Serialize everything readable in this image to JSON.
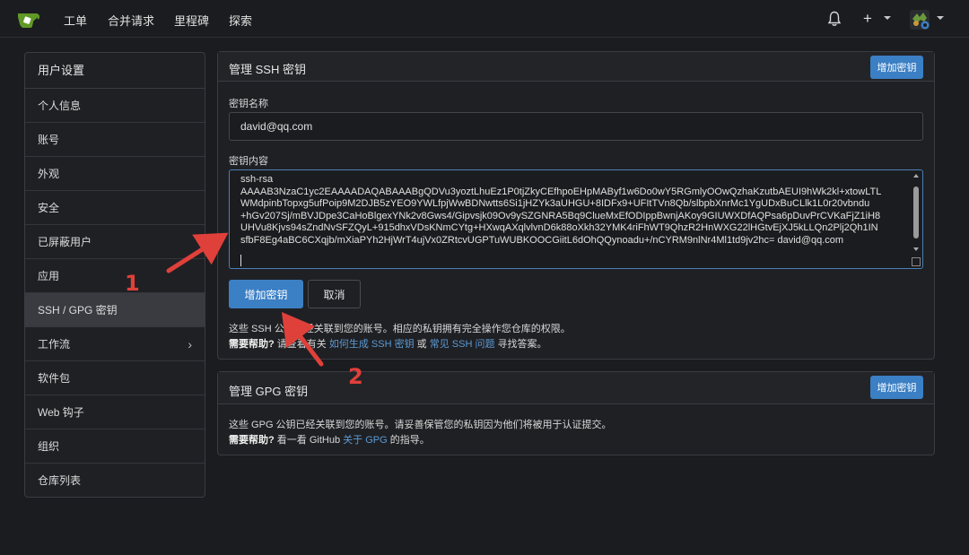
{
  "nav": {
    "links": [
      "工单",
      "合并请求",
      "里程碑",
      "探索"
    ],
    "plus_label": "+"
  },
  "sidebar": {
    "title": "用户设置",
    "items": [
      {
        "label": "个人信息"
      },
      {
        "label": "账号"
      },
      {
        "label": "外观"
      },
      {
        "label": "安全"
      },
      {
        "label": "已屏蔽用户"
      },
      {
        "label": "应用"
      },
      {
        "label": "SSH / GPG 密钥",
        "active": true
      },
      {
        "label": "工作流",
        "chevron": "›"
      },
      {
        "label": "软件包"
      },
      {
        "label": "Web 钩子"
      },
      {
        "label": "组织"
      },
      {
        "label": "仓库列表"
      }
    ]
  },
  "ssh": {
    "title": "管理 SSH 密钥",
    "head_button": "增加密钥",
    "name_label": "密钥名称",
    "name_value": "david@qq.com",
    "content_label": "密钥内容",
    "key_lines": [
      "ssh-rsa",
      "AAAAB3NzaC1yc2EAAAADAQABAAABgQDVu3yoztLhuEz1P0tjZkyCEfhpoEHpMAByf1w6Do0wY5RGmlyOOwQzhaKzutbAEUI9hWk2kl+xtowLTL",
      "WMdpinbTopxg5ufPoip9M2DJB5zYEO9YWLfpjWwBDNwtts6Si1jHZYk3aUHGU+8IDFx9+UFItTVn8Qb/slbpbXnrMc1YgUDxBuCLlk1L0r20vbndu",
      "+hGv207Sj/mBVJDpe3CaHoBlgexYNk2v8Gws4/Gipvsjk09Ov9ySZGNRA5Bq9ClueMxEfODIppBwnjAKoy9GIUWXDfAQPsa6pDuvPrCVKaFjZ1iH8",
      "UHVu8Kjvs94sZndNvSFZQyL+915dhxVDsKNmCYtg+HXwqAXqlvlvnD6k88oXkh32YMK4riFhWT9QhzR2HnWXG22lHGtvEjXJ5kLLQn2Plj2Qh1IN",
      "sfbF8Eg4aBC6CXqjb/mXiaPYh2HjWrT4ujVx0ZRtcvUGPTuWUBKOOCGiitL6dOhQQynoadu+/nCYRM9nlNr4Ml1td9jv2hc= david@qq.com"
    ],
    "add_button": "增加密钥",
    "cancel_button": "取消",
    "info_line": "这些 SSH 公钥已经关联到您的账号。相应的私钥拥有完全操作您仓库的权限。",
    "help_bold": "需要帮助?",
    "help_pre": " 请查看有关 ",
    "help_link1": "如何生成 SSH 密钥",
    "help_mid": " 或 ",
    "help_link2": "常见 SSH 问题",
    "help_post": " 寻找答案。"
  },
  "gpg": {
    "title": "管理 GPG 密钥",
    "head_button": "增加密钥",
    "info_line": "这些 GPG 公钥已经关联到您的账号。请妥善保管您的私钥因为他们将被用于认证提交。",
    "help_bold": "需要帮助?",
    "help_pre": " 看一看 GitHub ",
    "help_link": "关于 GPG",
    "help_post": " 的指导。"
  },
  "annotations": {
    "step1": "1",
    "step2": "2",
    "color": "#e0403a"
  },
  "colors": {
    "accent": "#3b7fc4",
    "link": "#5b9bd5",
    "background": "#1b1c1f"
  }
}
